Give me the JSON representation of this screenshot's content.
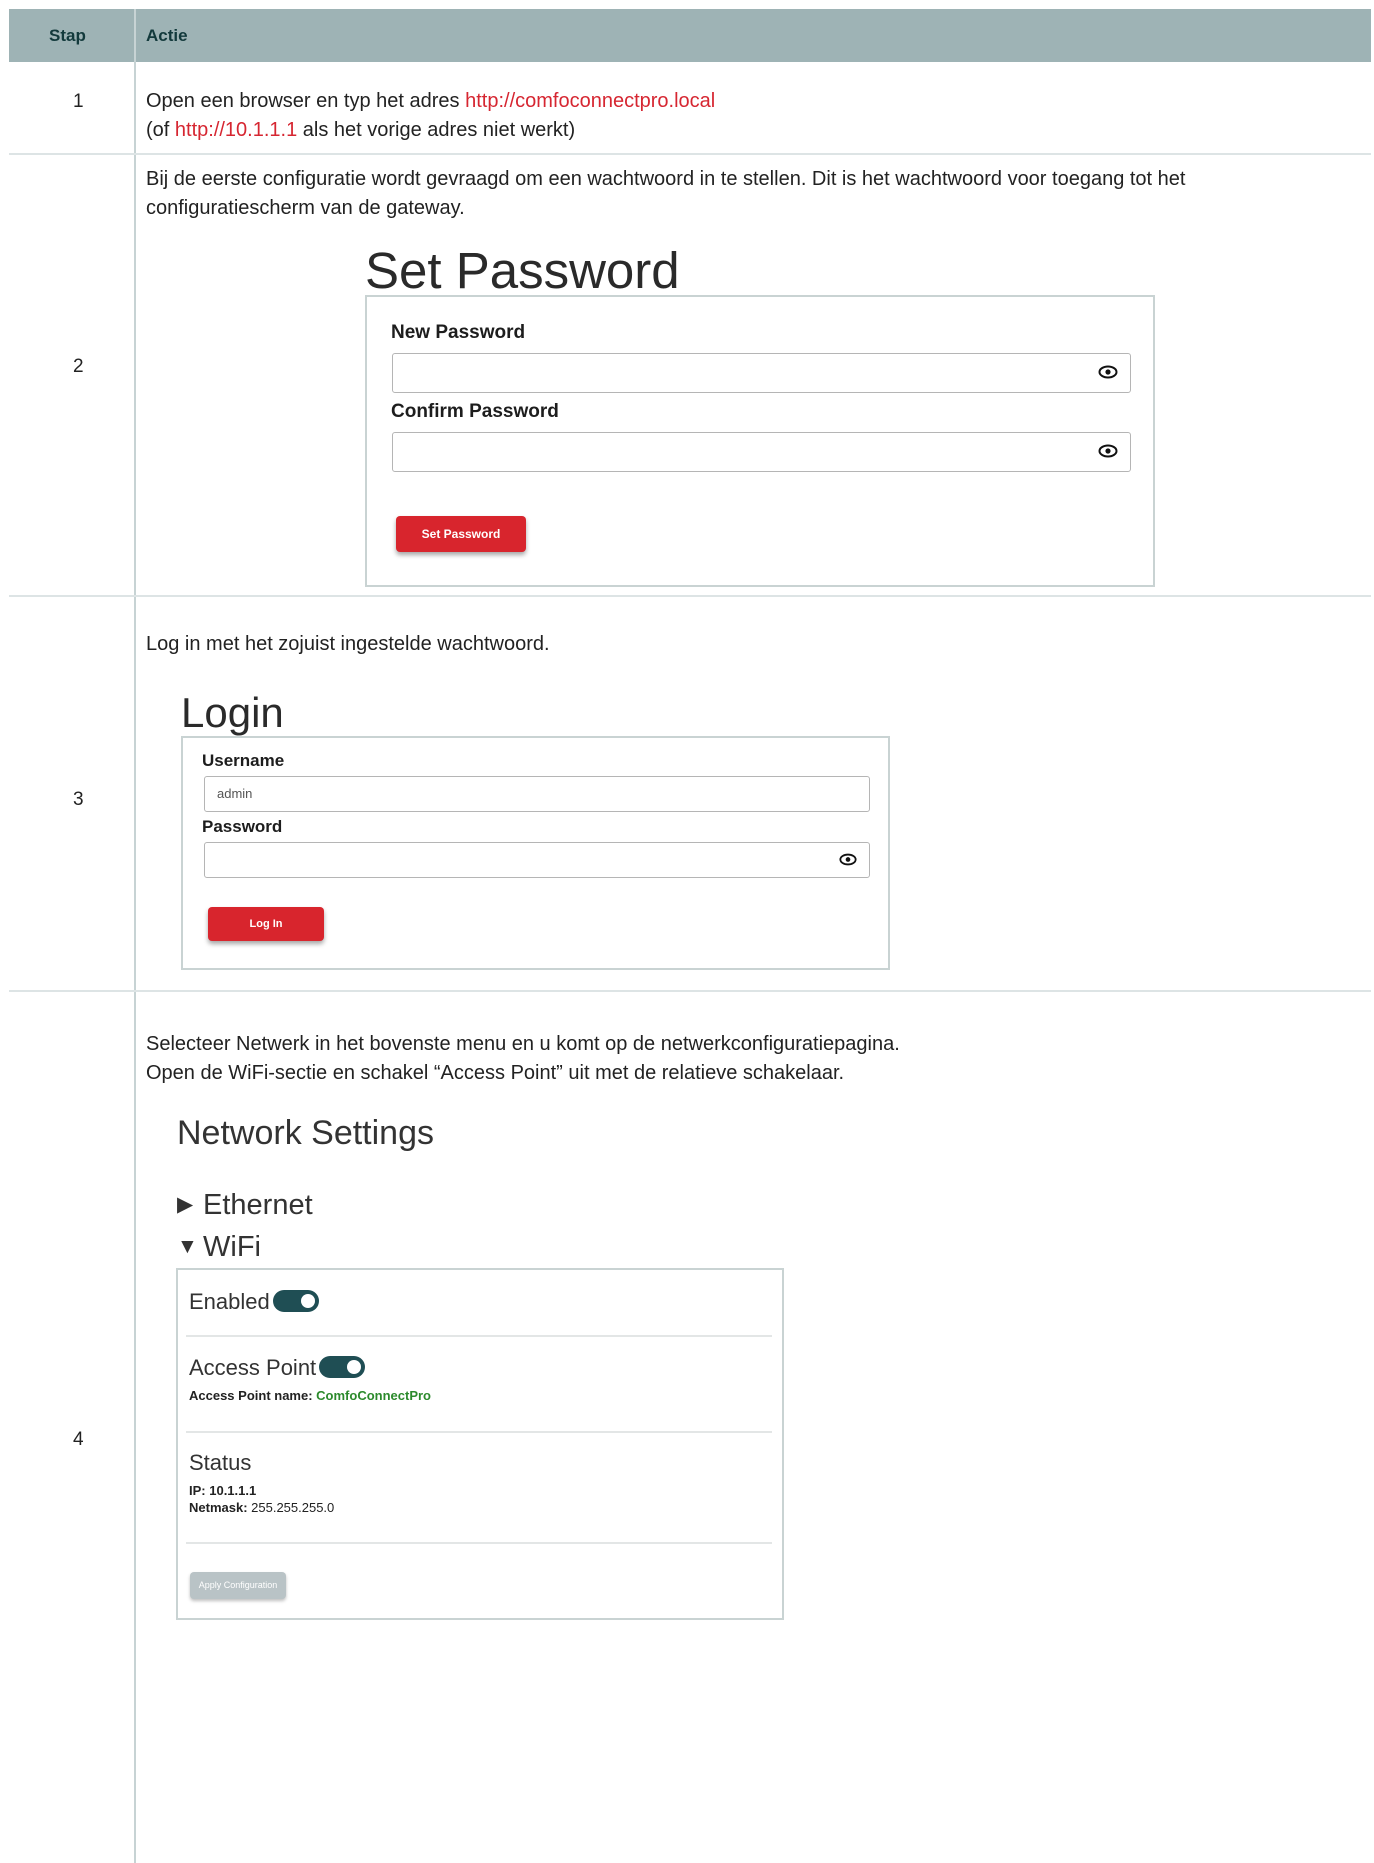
{
  "table": {
    "col_step": "Stap",
    "col_action": "Actie"
  },
  "steps": [
    {
      "num": "1",
      "line1_prefix": "Open een browser en typ het adres ",
      "line1_link": "http://comfoconnectpro.local",
      "line2_prefix": "(of ",
      "line2_link": "http://10.1.1.1",
      "line2_suffix": " als het vorige adres niet werkt)"
    },
    {
      "num": "2",
      "text": "Bij de eerste configuratie wordt gevraagd om een wachtwoord in te stellen. Dit is het wachtwoord voor toegang tot het configuratiescherm van de gateway.",
      "screen": {
        "title": "Set Password",
        "new_label": "New Password",
        "confirm_label": "Confirm Password",
        "button": "Set Password"
      }
    },
    {
      "num": "3",
      "text": "Log in met het zojuist ingestelde wachtwoord.",
      "screen": {
        "title": "Login",
        "username_label": "Username",
        "username_value": "admin",
        "password_label": "Password",
        "button": "Log In"
      }
    },
    {
      "num": "4",
      "line1": "Selecteer Netwerk in het bovenste menu en u komt op de netwerkconfiguratiepagina.",
      "line2": "Open de WiFi-sectie en schakel “Access Point” uit met de relatieve schakelaar.",
      "screen": {
        "title": "Network Settings",
        "ethernet": "Ethernet",
        "wifi": "WiFi",
        "enabled_label": "Enabled",
        "ap_label": "Access Point",
        "ap_name_label": "Access Point name: ",
        "ap_name_value": "ComfoConnectPro",
        "status_label": "Status",
        "ip_label": "IP: ",
        "ip_value": "10.1.1.1",
        "netmask_label": "Netmask: ",
        "netmask_value": "255.255.255.0",
        "apply_button": "Apply Configuration"
      }
    }
  ],
  "colors": {
    "header_bg": "#9eb3b5",
    "header_text": "#133a3c",
    "link": "#d62631",
    "button_red": "#d8252d",
    "toggle_on": "#1f4e54",
    "green_value": "#2c8a2c"
  }
}
